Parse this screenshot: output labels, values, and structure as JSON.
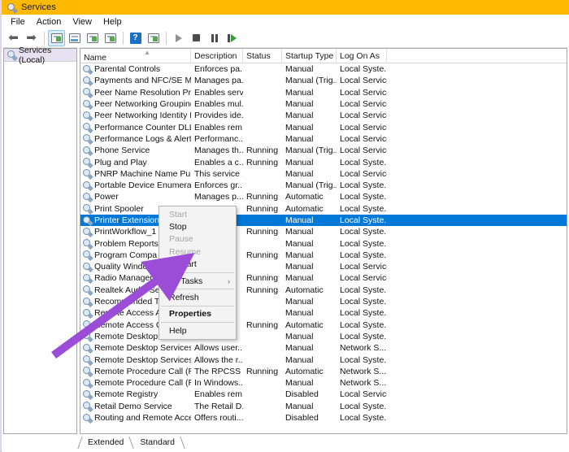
{
  "window": {
    "title": "Services",
    "title_icon": "services-gear-icon",
    "accent_titlebar": "#ffb900"
  },
  "menubar": {
    "items": [
      {
        "label": "File"
      },
      {
        "label": "Action"
      },
      {
        "label": "View"
      },
      {
        "label": "Help"
      }
    ]
  },
  "toolbar": {
    "buttons": [
      {
        "name": "back-button",
        "icon": "arrow-left-icon"
      },
      {
        "name": "forward-button",
        "icon": "arrow-right-icon"
      },
      {
        "name": "show-hide-console-tree-button",
        "icon": "console-tree-icon",
        "active": true
      },
      {
        "name": "properties-button",
        "icon": "properties-window-icon",
        "active": false
      },
      {
        "name": "refresh-button",
        "icon": "refresh-icon",
        "active": false
      },
      {
        "name": "export-list-button",
        "icon": "export-list-icon",
        "active": false
      },
      {
        "name": "help-button",
        "icon": "question-mark-icon"
      },
      {
        "name": "show-action-pane-button",
        "icon": "action-pane-icon"
      },
      {
        "name": "start-service-button",
        "icon": "play-icon"
      },
      {
        "name": "stop-service-button",
        "icon": "stop-icon"
      },
      {
        "name": "pause-service-button",
        "icon": "pause-icon"
      },
      {
        "name": "restart-service-button",
        "icon": "restart-icon"
      }
    ]
  },
  "sidebar": {
    "node_label": "Services (Local)",
    "node_icon": "services-gear-icon"
  },
  "table": {
    "columns": [
      {
        "key": "name",
        "label": "Name",
        "sorted": true,
        "sort_direction": "ascending"
      },
      {
        "key": "description",
        "label": "Description"
      },
      {
        "key": "status",
        "label": "Status"
      },
      {
        "key": "startup",
        "label": "Startup Type"
      },
      {
        "key": "logon",
        "label": "Log On As"
      }
    ],
    "selected_row_index": 13,
    "rows": [
      {
        "name": "Parental Controls",
        "description": "Enforces pa...",
        "status": "",
        "startup": "Manual",
        "logon": "Local Syste..."
      },
      {
        "name": "Payments and NFC/SE Man...",
        "description": "Manages pa...",
        "status": "",
        "startup": "Manual (Trig...",
        "logon": "Local Service"
      },
      {
        "name": "Peer Name Resolution Prot...",
        "description": "Enables serv...",
        "status": "",
        "startup": "Manual",
        "logon": "Local Service"
      },
      {
        "name": "Peer Networking Grouping",
        "description": "Enables mul...",
        "status": "",
        "startup": "Manual",
        "logon": "Local Service"
      },
      {
        "name": "Peer Networking Identity M...",
        "description": "Provides ide...",
        "status": "",
        "startup": "Manual",
        "logon": "Local Service"
      },
      {
        "name": "Performance Counter DLL ...",
        "description": "Enables rem...",
        "status": "",
        "startup": "Manual",
        "logon": "Local Service"
      },
      {
        "name": "Performance Logs & Alerts",
        "description": "Performanc...",
        "status": "",
        "startup": "Manual",
        "logon": "Local Service"
      },
      {
        "name": "Phone Service",
        "description": "Manages th...",
        "status": "Running",
        "startup": "Manual (Trig...",
        "logon": "Local Service"
      },
      {
        "name": "Plug and Play",
        "description": "Enables a c...",
        "status": "Running",
        "startup": "Manual",
        "logon": "Local Syste..."
      },
      {
        "name": "PNRP Machine Name Publi...",
        "description": "This service ...",
        "status": "",
        "startup": "Manual",
        "logon": "Local Service"
      },
      {
        "name": "Portable Device Enumerator...",
        "description": "Enforces gr...",
        "status": "",
        "startup": "Manual (Trig...",
        "logon": "Local Syste..."
      },
      {
        "name": "Power",
        "description": "Manages p...",
        "status": "Running",
        "startup": "Automatic",
        "logon": "Local Syste..."
      },
      {
        "name": "Print Spooler",
        "description": "",
        "status": "Running",
        "startup": "Automatic",
        "logon": "Local Syste..."
      },
      {
        "name": "Printer Extensions",
        "description": "",
        "status": "",
        "startup": "Manual",
        "logon": "Local Syste..."
      },
      {
        "name": "PrintWorkflow_1",
        "description": "",
        "status": "Running",
        "startup": "Manual",
        "logon": "Local Syste..."
      },
      {
        "name": "Problem Reports",
        "description": "",
        "status": "",
        "startup": "Manual",
        "logon": "Local Syste..."
      },
      {
        "name": "Program Compa",
        "description": "",
        "status": "Running",
        "startup": "Manual",
        "logon": "Local Syste..."
      },
      {
        "name": "Quality Window",
        "description": "",
        "status": "",
        "startup": "Manual",
        "logon": "Local Service"
      },
      {
        "name": "Radio Managem",
        "description": "",
        "status": "Running",
        "startup": "Manual",
        "logon": "Local Service"
      },
      {
        "name": "Realtek Audio Se",
        "description": "",
        "status": "Running",
        "startup": "Automatic",
        "logon": "Local Syste..."
      },
      {
        "name": "Recommended T",
        "description": "",
        "status": "",
        "startup": "Manual",
        "logon": "Local Syste..."
      },
      {
        "name": "Remote Access A",
        "description": "",
        "status": "",
        "startup": "Manual",
        "logon": "Local Syste..."
      },
      {
        "name": "Remote Access C",
        "description": "",
        "status": "Running",
        "startup": "Automatic",
        "logon": "Local Syste..."
      },
      {
        "name": "Remote Desktop",
        "description": "",
        "status": "",
        "startup": "Manual",
        "logon": "Local Syste..."
      },
      {
        "name": "Remote Desktop Services",
        "description": "Allows user...",
        "status": "",
        "startup": "Manual",
        "logon": "Network S..."
      },
      {
        "name": "Remote Desktop Services U...",
        "description": "Allows the r...",
        "status": "",
        "startup": "Manual",
        "logon": "Local Syste..."
      },
      {
        "name": "Remote Procedure Call (RPC)",
        "description": "The RPCSS s...",
        "status": "Running",
        "startup": "Automatic",
        "logon": "Network S..."
      },
      {
        "name": "Remote Procedure Call (RP...",
        "description": "In Windows...",
        "status": "",
        "startup": "Manual",
        "logon": "Network S..."
      },
      {
        "name": "Remote Registry",
        "description": "Enables rem...",
        "status": "",
        "startup": "Disabled",
        "logon": "Local Service"
      },
      {
        "name": "Retail Demo Service",
        "description": "The Retail D...",
        "status": "",
        "startup": "Manual",
        "logon": "Local Syste..."
      },
      {
        "name": "Routing and Remote Access",
        "description": "Offers routi...",
        "status": "",
        "startup": "Disabled",
        "logon": "Local Syste..."
      }
    ]
  },
  "context_menu": {
    "items": [
      {
        "label": "Start",
        "disabled": true,
        "bold": false,
        "submenu": false
      },
      {
        "label": "Stop",
        "disabled": false,
        "bold": false,
        "submenu": false
      },
      {
        "label": "Pause",
        "disabled": true,
        "bold": false,
        "submenu": false
      },
      {
        "label": "Resume",
        "disabled": true,
        "bold": false,
        "submenu": false
      },
      {
        "label": "Restart",
        "disabled": false,
        "bold": false,
        "submenu": false
      },
      {
        "separator": true
      },
      {
        "label": "All Tasks",
        "disabled": false,
        "bold": false,
        "submenu": true,
        "submenu_arrow": "›"
      },
      {
        "separator": true
      },
      {
        "label": "Refresh",
        "disabled": false,
        "bold": false,
        "submenu": false
      },
      {
        "separator": true
      },
      {
        "label": "Properties",
        "disabled": false,
        "bold": true,
        "submenu": false
      },
      {
        "separator": true
      },
      {
        "label": "Help",
        "disabled": false,
        "bold": false,
        "submenu": false
      }
    ]
  },
  "tabs": {
    "items": [
      {
        "label": "Extended",
        "active": false
      },
      {
        "label": "Standard",
        "active": true
      }
    ]
  },
  "annotation": {
    "arrow_color": "#9b4dd8",
    "points_to": "Restart"
  }
}
